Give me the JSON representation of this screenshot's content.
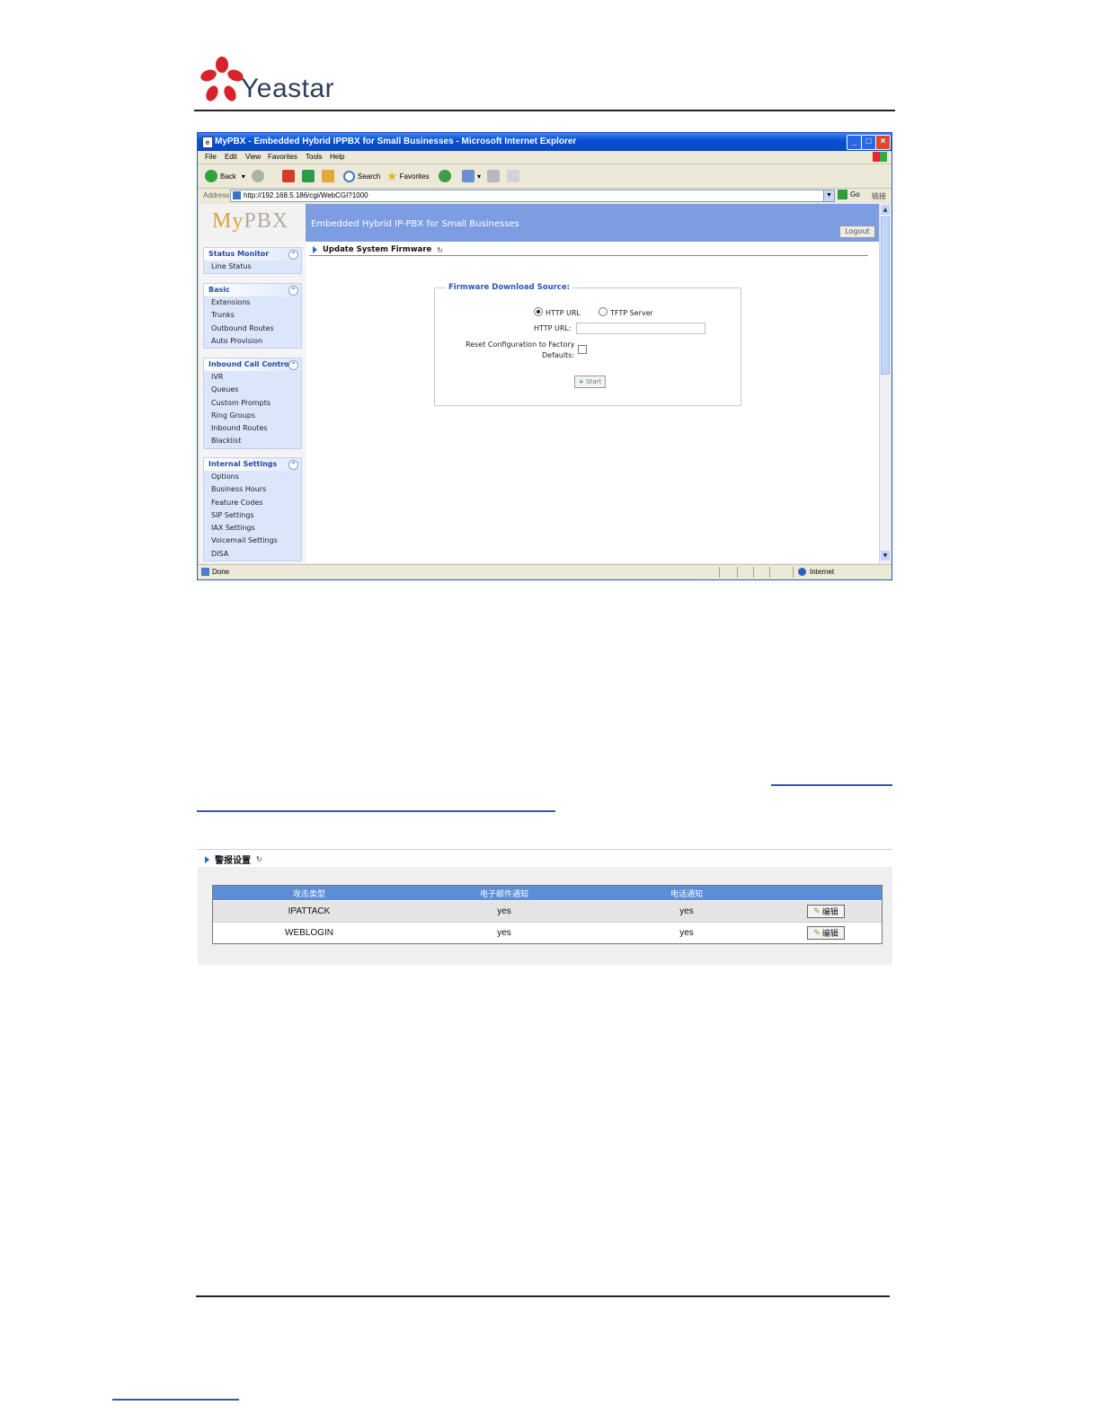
{
  "doc": {
    "logo_text": "Yeastar",
    "logo_colors": {
      "flower": "#d8232a",
      "text": "#2f3f5a"
    }
  },
  "browser": {
    "window_title": "MyPBX - Embedded Hybrid IPPBX for Small Businesses - Microsoft Internet Explorer",
    "menu": [
      "File",
      "Edit",
      "View",
      "Favorites",
      "Tools",
      "Help"
    ],
    "toolbar": {
      "back": "Back",
      "search": "Search",
      "favorites": "Favorites"
    },
    "address_label": "Address",
    "address": "http://192.168.5.186/cgi/WebCGI?1000",
    "go": "Go",
    "links": "链接",
    "status": "Done",
    "zone": "Internet"
  },
  "pbx": {
    "logo": {
      "my": "My",
      "pbx": "PBX"
    },
    "tagline": "Embedded Hybrid IP-PBX for Small Businesses",
    "logout": "Logout",
    "sidebar": [
      {
        "title": "Status Monitor",
        "items": [
          "Line Status"
        ]
      },
      {
        "title": "Basic",
        "items": [
          "Extensions",
          "Trunks",
          "Outbound Routes",
          "Auto Provision"
        ]
      },
      {
        "title": "Inbound Call Control",
        "items": [
          "IVR",
          "Queues",
          "Custom Prompts",
          "Ring Groups",
          "Inbound Routes",
          "Blacklist"
        ]
      },
      {
        "title": "Internal Settings",
        "items": [
          "Options",
          "Business Hours",
          "Feature Codes",
          "SIP Settings",
          "IAX Settings",
          "Voicemail Settings",
          "DISA"
        ]
      }
    ],
    "section_title": "Update System Firmware",
    "firmware": {
      "legend": "Firmware Download Source:",
      "option_http": "HTTP URL",
      "option_tftp": "TFTP Server",
      "selected": "HTTP URL",
      "url_label": "HTTP URL:",
      "url_value": "",
      "reset_label_1": "Reset Configuration to Factory",
      "reset_label_2": "Defaults:",
      "reset_checked": false,
      "start": "Start"
    }
  },
  "alarm": {
    "title": "警报设置",
    "columns": [
      "攻击类型",
      "电子邮件通知",
      "电话通知",
      ""
    ],
    "rows": [
      {
        "type": "IPATTACK",
        "email": "yes",
        "phone": "yes",
        "action": "编辑"
      },
      {
        "type": "WEBLOGIN",
        "email": "yes",
        "phone": "yes",
        "action": "编辑"
      }
    ]
  }
}
